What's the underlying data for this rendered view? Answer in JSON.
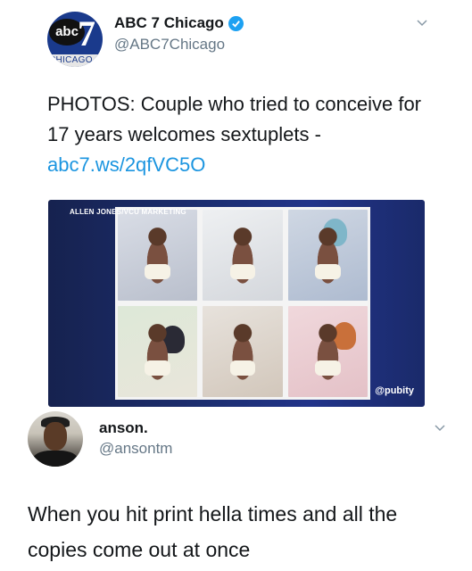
{
  "tweet1": {
    "avatar": {
      "brand": "abc",
      "channel": "7",
      "city": "CHICAGO"
    },
    "display_name": "ABC 7 Chicago",
    "handle": "@ABC7Chicago",
    "verified": true,
    "text_prefix": "PHOTOS: Couple who tried to conceive for 17 years welcomes sextuplets - ",
    "link": "abc7.ws/2qfVC5O",
    "media": {
      "credit": "ALLEN JONES/VCU MARKETING",
      "watermark": "@pubity",
      "photo_count": 6
    }
  },
  "tweet2": {
    "display_name": "anson.",
    "handle": "@ansontm",
    "text": "When you hit print hella times and all the copies come out at once"
  },
  "colors": {
    "link": "#1b95e0",
    "handle": "#657786",
    "verified": "#1da1f2",
    "media_bg": "#1d2f73"
  },
  "icons": [
    "verified-badge-icon",
    "chevron-down-icon"
  ]
}
